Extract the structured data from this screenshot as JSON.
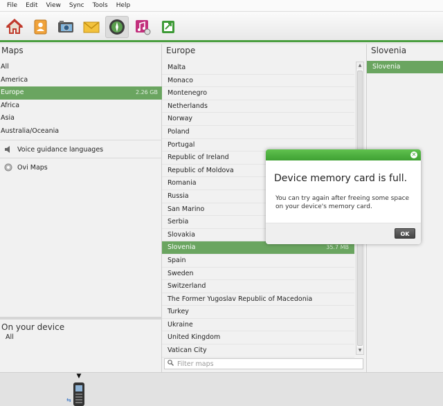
{
  "menu": [
    "File",
    "Edit",
    "View",
    "Sync",
    "Tools",
    "Help"
  ],
  "toolbar": {
    "tools": [
      {
        "icon": "home-icon",
        "name": "home"
      },
      {
        "icon": "contacts-icon",
        "name": "contacts"
      },
      {
        "icon": "photos-icon",
        "name": "photos"
      },
      {
        "icon": "messages-icon",
        "name": "messages"
      },
      {
        "icon": "maps-icon",
        "name": "maps",
        "active": true
      },
      {
        "icon": "music-icon",
        "name": "music"
      },
      {
        "icon": "sync-icon",
        "name": "sync"
      }
    ],
    "accent_color": "#4a9e3f"
  },
  "maps_panel": {
    "title": "Maps",
    "items": [
      {
        "label": "All",
        "size": ""
      },
      {
        "label": "America",
        "size": ""
      },
      {
        "label": "Europe",
        "size": "2.26 GB",
        "selected": true
      },
      {
        "label": "Africa",
        "size": ""
      },
      {
        "label": "Asia",
        "size": ""
      },
      {
        "label": "Australia/Oceania",
        "size": ""
      }
    ],
    "extras": [
      {
        "label": "Voice guidance languages",
        "icon": "speaker-icon"
      },
      {
        "label": "Ovi Maps",
        "icon": "ovi-icon"
      }
    ]
  },
  "device_panel": {
    "title": "On your device",
    "items": [
      "All"
    ]
  },
  "europe_panel": {
    "title": "Europe",
    "countries": [
      {
        "label": "Malta",
        "size": ""
      },
      {
        "label": "Monaco",
        "size": ""
      },
      {
        "label": "Montenegro",
        "size": ""
      },
      {
        "label": "Netherlands",
        "size": ""
      },
      {
        "label": "Norway",
        "size": ""
      },
      {
        "label": "Poland",
        "size": ""
      },
      {
        "label": "Portugal",
        "size": ""
      },
      {
        "label": "Republic of Ireland",
        "size": ""
      },
      {
        "label": "Republic of Moldova",
        "size": ""
      },
      {
        "label": "Romania",
        "size": ""
      },
      {
        "label": "Russia",
        "size": ""
      },
      {
        "label": "San Marino",
        "size": ""
      },
      {
        "label": "Serbia",
        "size": ""
      },
      {
        "label": "Slovakia",
        "size": ""
      },
      {
        "label": "Slovenia",
        "size": "35.7 MB",
        "selected": true
      },
      {
        "label": "Spain",
        "size": ""
      },
      {
        "label": "Sweden",
        "size": ""
      },
      {
        "label": "Switzerland",
        "size": ""
      },
      {
        "label": "The Former Yugoslav Republic of Macedonia",
        "size": ""
      },
      {
        "label": "Turkey",
        "size": ""
      },
      {
        "label": "Ukraine",
        "size": ""
      },
      {
        "label": "United Kingdom",
        "size": ""
      },
      {
        "label": "Vatican City",
        "size": ""
      }
    ],
    "filter_placeholder": "Filter maps"
  },
  "detail_panel": {
    "title": "Slovenia",
    "selected_item": "Slovenia"
  },
  "dialog": {
    "title": "Device memory card is full.",
    "message": "You can try again after freeing some space on your device's memory card.",
    "ok_label": "OK"
  },
  "colors": {
    "selection": "#6aa560",
    "dialog_header": "#3fa033"
  }
}
